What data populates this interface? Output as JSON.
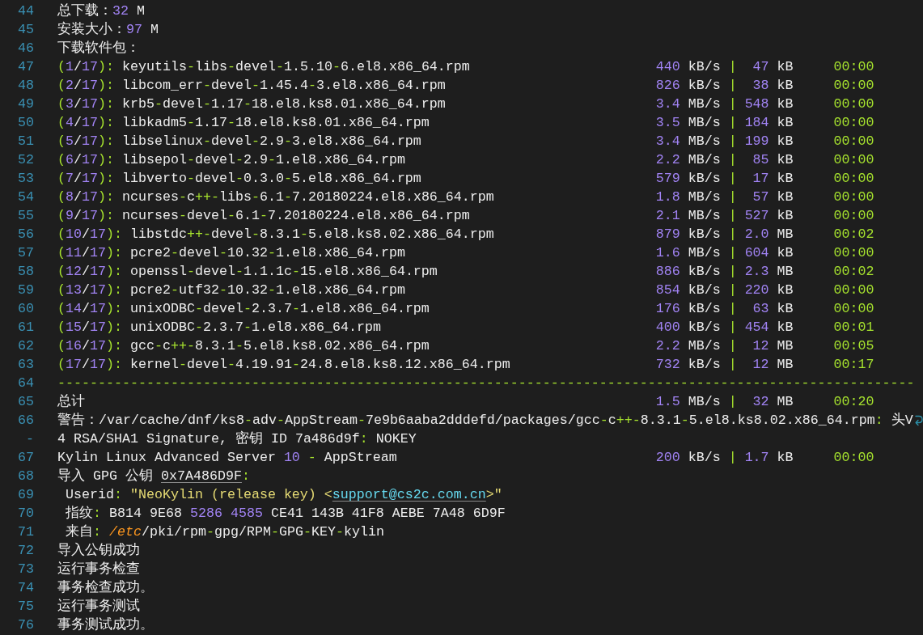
{
  "editor": {
    "lines": [
      {
        "number": "44",
        "wrapped": false,
        "tokens": [
          {
            "kind": "text",
            "text": "总下载："
          },
          {
            "kind": "number",
            "text": "32"
          },
          {
            "kind": "text",
            "text": " M"
          }
        ]
      },
      {
        "number": "45",
        "wrapped": false,
        "tokens": [
          {
            "kind": "text",
            "text": "安装大小："
          },
          {
            "kind": "number",
            "text": "97"
          },
          {
            "kind": "text",
            "text": " M"
          }
        ]
      },
      {
        "number": "46",
        "wrapped": false,
        "tokens": [
          {
            "kind": "text",
            "text": "下载软件包："
          }
        ]
      },
      {
        "number": "47",
        "wrapped": false,
        "tokens": [
          {
            "kind": "operator",
            "text": "("
          },
          {
            "kind": "number",
            "text": "1"
          },
          {
            "kind": "text",
            "text": "/"
          },
          {
            "kind": "number",
            "text": "17"
          },
          {
            "kind": "operator",
            "text": "):"
          },
          {
            "kind": "text",
            "text": " keyutils"
          },
          {
            "kind": "operator",
            "text": "-"
          },
          {
            "kind": "text",
            "text": "libs"
          },
          {
            "kind": "operator",
            "text": "-"
          },
          {
            "kind": "text",
            "text": "devel"
          },
          {
            "kind": "operator",
            "text": "-"
          },
          {
            "kind": "text",
            "text": "1.5.10"
          },
          {
            "kind": "operator",
            "text": "-"
          },
          {
            "kind": "text",
            "text": "6.el8.x86_64.rpm"
          }
        ],
        "transfer": {
          "speed": "440",
          "speed_unit": "kB/s",
          "separator": "|",
          "size": "47",
          "size_unit": "kB",
          "time": "00:00"
        }
      },
      {
        "number": "48",
        "wrapped": false,
        "tokens": [
          {
            "kind": "operator",
            "text": "("
          },
          {
            "kind": "number",
            "text": "2"
          },
          {
            "kind": "text",
            "text": "/"
          },
          {
            "kind": "number",
            "text": "17"
          },
          {
            "kind": "operator",
            "text": "):"
          },
          {
            "kind": "text",
            "text": " libcom_err"
          },
          {
            "kind": "operator",
            "text": "-"
          },
          {
            "kind": "text",
            "text": "devel"
          },
          {
            "kind": "operator",
            "text": "-"
          },
          {
            "kind": "text",
            "text": "1.45.4"
          },
          {
            "kind": "operator",
            "text": "-"
          },
          {
            "kind": "text",
            "text": "3.el8.x86_64.rpm"
          }
        ],
        "transfer": {
          "speed": "826",
          "speed_unit": "kB/s",
          "separator": "|",
          "size": "38",
          "size_unit": "kB",
          "time": "00:00"
        }
      },
      {
        "number": "49",
        "wrapped": false,
        "tokens": [
          {
            "kind": "operator",
            "text": "("
          },
          {
            "kind": "number",
            "text": "3"
          },
          {
            "kind": "text",
            "text": "/"
          },
          {
            "kind": "number",
            "text": "17"
          },
          {
            "kind": "operator",
            "text": "):"
          },
          {
            "kind": "text",
            "text": " krb5"
          },
          {
            "kind": "operator",
            "text": "-"
          },
          {
            "kind": "text",
            "text": "devel"
          },
          {
            "kind": "operator",
            "text": "-"
          },
          {
            "kind": "text",
            "text": "1.17"
          },
          {
            "kind": "operator",
            "text": "-"
          },
          {
            "kind": "text",
            "text": "18.el8.ks8.01.x86_64.rpm"
          }
        ],
        "transfer": {
          "speed": "3.4",
          "speed_unit": "MB/s",
          "separator": "|",
          "size": "548",
          "size_unit": "kB",
          "time": "00:00"
        }
      },
      {
        "number": "50",
        "wrapped": false,
        "tokens": [
          {
            "kind": "operator",
            "text": "("
          },
          {
            "kind": "number",
            "text": "4"
          },
          {
            "kind": "text",
            "text": "/"
          },
          {
            "kind": "number",
            "text": "17"
          },
          {
            "kind": "operator",
            "text": "):"
          },
          {
            "kind": "text",
            "text": " libkadm5"
          },
          {
            "kind": "operator",
            "text": "-"
          },
          {
            "kind": "text",
            "text": "1.17"
          },
          {
            "kind": "operator",
            "text": "-"
          },
          {
            "kind": "text",
            "text": "18.el8.ks8.01.x86_64.rpm"
          }
        ],
        "transfer": {
          "speed": "3.5",
          "speed_unit": "MB/s",
          "separator": "|",
          "size": "184",
          "size_unit": "kB",
          "time": "00:00"
        }
      },
      {
        "number": "51",
        "wrapped": false,
        "tokens": [
          {
            "kind": "operator",
            "text": "("
          },
          {
            "kind": "number",
            "text": "5"
          },
          {
            "kind": "text",
            "text": "/"
          },
          {
            "kind": "number",
            "text": "17"
          },
          {
            "kind": "operator",
            "text": "):"
          },
          {
            "kind": "text",
            "text": " libselinux"
          },
          {
            "kind": "operator",
            "text": "-"
          },
          {
            "kind": "text",
            "text": "devel"
          },
          {
            "kind": "operator",
            "text": "-"
          },
          {
            "kind": "text",
            "text": "2.9"
          },
          {
            "kind": "operator",
            "text": "-"
          },
          {
            "kind": "text",
            "text": "3.el8.x86_64.rpm"
          }
        ],
        "transfer": {
          "speed": "3.4",
          "speed_unit": "MB/s",
          "separator": "|",
          "size": "199",
          "size_unit": "kB",
          "time": "00:00"
        }
      },
      {
        "number": "52",
        "wrapped": false,
        "tokens": [
          {
            "kind": "operator",
            "text": "("
          },
          {
            "kind": "number",
            "text": "6"
          },
          {
            "kind": "text",
            "text": "/"
          },
          {
            "kind": "number",
            "text": "17"
          },
          {
            "kind": "operator",
            "text": "):"
          },
          {
            "kind": "text",
            "text": " libsepol"
          },
          {
            "kind": "operator",
            "text": "-"
          },
          {
            "kind": "text",
            "text": "devel"
          },
          {
            "kind": "operator",
            "text": "-"
          },
          {
            "kind": "text",
            "text": "2.9"
          },
          {
            "kind": "operator",
            "text": "-"
          },
          {
            "kind": "text",
            "text": "1.el8.x86_64.rpm"
          }
        ],
        "transfer": {
          "speed": "2.2",
          "speed_unit": "MB/s",
          "separator": "|",
          "size": "85",
          "size_unit": "kB",
          "time": "00:00"
        }
      },
      {
        "number": "53",
        "wrapped": false,
        "tokens": [
          {
            "kind": "operator",
            "text": "("
          },
          {
            "kind": "number",
            "text": "7"
          },
          {
            "kind": "text",
            "text": "/"
          },
          {
            "kind": "number",
            "text": "17"
          },
          {
            "kind": "operator",
            "text": "):"
          },
          {
            "kind": "text",
            "text": " libverto"
          },
          {
            "kind": "operator",
            "text": "-"
          },
          {
            "kind": "text",
            "text": "devel"
          },
          {
            "kind": "operator",
            "text": "-"
          },
          {
            "kind": "text",
            "text": "0.3.0"
          },
          {
            "kind": "operator",
            "text": "-"
          },
          {
            "kind": "text",
            "text": "5.el8.x86_64.rpm"
          }
        ],
        "transfer": {
          "speed": "579",
          "speed_unit": "kB/s",
          "separator": "|",
          "size": "17",
          "size_unit": "kB",
          "time": "00:00"
        }
      },
      {
        "number": "54",
        "wrapped": false,
        "tokens": [
          {
            "kind": "operator",
            "text": "("
          },
          {
            "kind": "number",
            "text": "8"
          },
          {
            "kind": "text",
            "text": "/"
          },
          {
            "kind": "number",
            "text": "17"
          },
          {
            "kind": "operator",
            "text": "):"
          },
          {
            "kind": "text",
            "text": " ncurses"
          },
          {
            "kind": "operator",
            "text": "-"
          },
          {
            "kind": "text",
            "text": "c"
          },
          {
            "kind": "operator",
            "text": "++-"
          },
          {
            "kind": "text",
            "text": "libs"
          },
          {
            "kind": "operator",
            "text": "-"
          },
          {
            "kind": "text",
            "text": "6.1"
          },
          {
            "kind": "operator",
            "text": "-"
          },
          {
            "kind": "text",
            "text": "7.20180224.el8.x86_64.rpm"
          }
        ],
        "transfer": {
          "speed": "1.8",
          "speed_unit": "MB/s",
          "separator": "|",
          "size": "57",
          "size_unit": "kB",
          "time": "00:00"
        }
      },
      {
        "number": "55",
        "wrapped": false,
        "tokens": [
          {
            "kind": "operator",
            "text": "("
          },
          {
            "kind": "number",
            "text": "9"
          },
          {
            "kind": "text",
            "text": "/"
          },
          {
            "kind": "number",
            "text": "17"
          },
          {
            "kind": "operator",
            "text": "):"
          },
          {
            "kind": "text",
            "text": " ncurses"
          },
          {
            "kind": "operator",
            "text": "-"
          },
          {
            "kind": "text",
            "text": "devel"
          },
          {
            "kind": "operator",
            "text": "-"
          },
          {
            "kind": "text",
            "text": "6.1"
          },
          {
            "kind": "operator",
            "text": "-"
          },
          {
            "kind": "text",
            "text": "7.20180224.el8.x86_64.rpm"
          }
        ],
        "transfer": {
          "speed": "2.1",
          "speed_unit": "MB/s",
          "separator": "|",
          "size": "527",
          "size_unit": "kB",
          "time": "00:00"
        }
      },
      {
        "number": "56",
        "wrapped": false,
        "tokens": [
          {
            "kind": "operator",
            "text": "("
          },
          {
            "kind": "number",
            "text": "10"
          },
          {
            "kind": "text",
            "text": "/"
          },
          {
            "kind": "number",
            "text": "17"
          },
          {
            "kind": "operator",
            "text": "):"
          },
          {
            "kind": "text",
            "text": " libstdc"
          },
          {
            "kind": "operator",
            "text": "++-"
          },
          {
            "kind": "text",
            "text": "devel"
          },
          {
            "kind": "operator",
            "text": "-"
          },
          {
            "kind": "text",
            "text": "8.3.1"
          },
          {
            "kind": "operator",
            "text": "-"
          },
          {
            "kind": "text",
            "text": "5.el8.ks8.02.x86_64.rpm"
          }
        ],
        "transfer": {
          "speed": "879",
          "speed_unit": "kB/s",
          "separator": "|",
          "size": "2.0",
          "size_unit": "MB",
          "time": "00:02"
        }
      },
      {
        "number": "57",
        "wrapped": false,
        "tokens": [
          {
            "kind": "operator",
            "text": "("
          },
          {
            "kind": "number",
            "text": "11"
          },
          {
            "kind": "text",
            "text": "/"
          },
          {
            "kind": "number",
            "text": "17"
          },
          {
            "kind": "operator",
            "text": "):"
          },
          {
            "kind": "text",
            "text": " pcre2"
          },
          {
            "kind": "operator",
            "text": "-"
          },
          {
            "kind": "text",
            "text": "devel"
          },
          {
            "kind": "operator",
            "text": "-"
          },
          {
            "kind": "text",
            "text": "10.32"
          },
          {
            "kind": "operator",
            "text": "-"
          },
          {
            "kind": "text",
            "text": "1.el8.x86_64.rpm"
          }
        ],
        "transfer": {
          "speed": "1.6",
          "speed_unit": "MB/s",
          "separator": "|",
          "size": "604",
          "size_unit": "kB",
          "time": "00:00"
        }
      },
      {
        "number": "58",
        "wrapped": false,
        "tokens": [
          {
            "kind": "operator",
            "text": "("
          },
          {
            "kind": "number",
            "text": "12"
          },
          {
            "kind": "text",
            "text": "/"
          },
          {
            "kind": "number",
            "text": "17"
          },
          {
            "kind": "operator",
            "text": "):"
          },
          {
            "kind": "text",
            "text": " openssl"
          },
          {
            "kind": "operator",
            "text": "-"
          },
          {
            "kind": "text",
            "text": "devel"
          },
          {
            "kind": "operator",
            "text": "-"
          },
          {
            "kind": "text",
            "text": "1.1.1c"
          },
          {
            "kind": "operator",
            "text": "-"
          },
          {
            "kind": "text",
            "text": "15.el8.x86_64.rpm"
          }
        ],
        "transfer": {
          "speed": "886",
          "speed_unit": "kB/s",
          "separator": "|",
          "size": "2.3",
          "size_unit": "MB",
          "time": "00:02"
        }
      },
      {
        "number": "59",
        "wrapped": false,
        "tokens": [
          {
            "kind": "operator",
            "text": "("
          },
          {
            "kind": "number",
            "text": "13"
          },
          {
            "kind": "text",
            "text": "/"
          },
          {
            "kind": "number",
            "text": "17"
          },
          {
            "kind": "operator",
            "text": "):"
          },
          {
            "kind": "text",
            "text": " pcre2"
          },
          {
            "kind": "operator",
            "text": "-"
          },
          {
            "kind": "text",
            "text": "utf32"
          },
          {
            "kind": "operator",
            "text": "-"
          },
          {
            "kind": "text",
            "text": "10.32"
          },
          {
            "kind": "operator",
            "text": "-"
          },
          {
            "kind": "text",
            "text": "1.el8.x86_64.rpm"
          }
        ],
        "transfer": {
          "speed": "854",
          "speed_unit": "kB/s",
          "separator": "|",
          "size": "220",
          "size_unit": "kB",
          "time": "00:00"
        }
      },
      {
        "number": "60",
        "wrapped": false,
        "tokens": [
          {
            "kind": "operator",
            "text": "("
          },
          {
            "kind": "number",
            "text": "14"
          },
          {
            "kind": "text",
            "text": "/"
          },
          {
            "kind": "number",
            "text": "17"
          },
          {
            "kind": "operator",
            "text": "):"
          },
          {
            "kind": "text",
            "text": " unixODBC"
          },
          {
            "kind": "operator",
            "text": "-"
          },
          {
            "kind": "text",
            "text": "devel"
          },
          {
            "kind": "operator",
            "text": "-"
          },
          {
            "kind": "text",
            "text": "2.3.7"
          },
          {
            "kind": "operator",
            "text": "-"
          },
          {
            "kind": "text",
            "text": "1.el8.x86_64.rpm"
          }
        ],
        "transfer": {
          "speed": "176",
          "speed_unit": "kB/s",
          "separator": "|",
          "size": "63",
          "size_unit": "kB",
          "time": "00:00"
        }
      },
      {
        "number": "61",
        "wrapped": false,
        "tokens": [
          {
            "kind": "operator",
            "text": "("
          },
          {
            "kind": "number",
            "text": "15"
          },
          {
            "kind": "text",
            "text": "/"
          },
          {
            "kind": "number",
            "text": "17"
          },
          {
            "kind": "operator",
            "text": "):"
          },
          {
            "kind": "text",
            "text": " unixODBC"
          },
          {
            "kind": "operator",
            "text": "-"
          },
          {
            "kind": "text",
            "text": "2.3.7"
          },
          {
            "kind": "operator",
            "text": "-"
          },
          {
            "kind": "text",
            "text": "1.el8.x86_64.rpm"
          }
        ],
        "transfer": {
          "speed": "400",
          "speed_unit": "kB/s",
          "separator": "|",
          "size": "454",
          "size_unit": "kB",
          "time": "00:01"
        }
      },
      {
        "number": "62",
        "wrapped": false,
        "tokens": [
          {
            "kind": "operator",
            "text": "("
          },
          {
            "kind": "number",
            "text": "16"
          },
          {
            "kind": "text",
            "text": "/"
          },
          {
            "kind": "number",
            "text": "17"
          },
          {
            "kind": "operator",
            "text": "):"
          },
          {
            "kind": "text",
            "text": " gcc"
          },
          {
            "kind": "operator",
            "text": "-"
          },
          {
            "kind": "text",
            "text": "c"
          },
          {
            "kind": "operator",
            "text": "++-"
          },
          {
            "kind": "text",
            "text": "8.3.1"
          },
          {
            "kind": "operator",
            "text": "-"
          },
          {
            "kind": "text",
            "text": "5.el8.ks8.02.x86_64.rpm"
          }
        ],
        "transfer": {
          "speed": "2.2",
          "speed_unit": "MB/s",
          "separator": "|",
          "size": "12",
          "size_unit": "MB",
          "time": "00:05"
        }
      },
      {
        "number": "63",
        "wrapped": false,
        "tokens": [
          {
            "kind": "operator",
            "text": "("
          },
          {
            "kind": "number",
            "text": "17"
          },
          {
            "kind": "text",
            "text": "/"
          },
          {
            "kind": "number",
            "text": "17"
          },
          {
            "kind": "operator",
            "text": "):"
          },
          {
            "kind": "text",
            "text": " kernel"
          },
          {
            "kind": "operator",
            "text": "-"
          },
          {
            "kind": "text",
            "text": "devel"
          },
          {
            "kind": "operator",
            "text": "-"
          },
          {
            "kind": "text",
            "text": "4.19.91"
          },
          {
            "kind": "operator",
            "text": "-"
          },
          {
            "kind": "text",
            "text": "24.8.el8.ks8.12.x86_64.rpm"
          }
        ],
        "transfer": {
          "speed": "732",
          "speed_unit": "kB/s",
          "separator": "|",
          "size": "12",
          "size_unit": "MB",
          "time": "00:17"
        }
      },
      {
        "number": "64",
        "wrapped": false,
        "tokens": [
          {
            "kind": "operator",
            "text": "----------------------------------------------------------------------------------------------------------"
          }
        ]
      },
      {
        "number": "65",
        "wrapped": false,
        "tokens": [
          {
            "kind": "text",
            "text": "总计"
          }
        ],
        "transfer": {
          "speed": "1.5",
          "speed_unit": "MB/s",
          "separator": "|",
          "size": "32",
          "size_unit": "MB",
          "time": "00:20"
        }
      },
      {
        "number": "66",
        "wrapped": true,
        "tokens": [
          {
            "kind": "text",
            "text": "警告：/var/cache/dnf/ks8"
          },
          {
            "kind": "operator",
            "text": "-"
          },
          {
            "kind": "text",
            "text": "adv"
          },
          {
            "kind": "operator",
            "text": "-"
          },
          {
            "kind": "text",
            "text": "AppStream"
          },
          {
            "kind": "operator",
            "text": "-"
          },
          {
            "kind": "text",
            "text": "7e9b6aaba2dddefd/packages/gcc"
          },
          {
            "kind": "operator",
            "text": "-"
          },
          {
            "kind": "text",
            "text": "c"
          },
          {
            "kind": "operator",
            "text": "++-"
          },
          {
            "kind": "text",
            "text": "8.3.1"
          },
          {
            "kind": "operator",
            "text": "-"
          },
          {
            "kind": "text",
            "text": "5.el8.ks8.02.x86_64.rpm"
          },
          {
            "kind": "operator",
            "text": ":"
          },
          {
            "kind": "text",
            "text": " 头V"
          }
        ]
      },
      {
        "number": "-",
        "wrapped": false,
        "tokens": [
          {
            "kind": "text",
            "text": "4 RSA/SHA1 Signature, 密钥 ID 7a486d9f"
          },
          {
            "kind": "operator",
            "text": ":"
          },
          {
            "kind": "text",
            "text": " NOKEY"
          }
        ]
      },
      {
        "number": "67",
        "wrapped": false,
        "tokens": [
          {
            "kind": "text",
            "text": "Kylin Linux Advanced Server "
          },
          {
            "kind": "number",
            "text": "10"
          },
          {
            "kind": "operator",
            "text": " -"
          },
          {
            "kind": "text",
            "text": " AppStream"
          }
        ],
        "transfer": {
          "speed": "200",
          "speed_unit": "kB/s",
          "separator": "|",
          "size": "1.7",
          "size_unit": "kB",
          "time": "00:00"
        }
      },
      {
        "number": "68",
        "wrapped": false,
        "tokens": [
          {
            "kind": "text",
            "text": "导入 GPG 公钥 "
          },
          {
            "kind": "underlined",
            "text": "0x7A486D9F"
          },
          {
            "kind": "operator",
            "text": ":"
          }
        ]
      },
      {
        "number": "69",
        "wrapped": false,
        "tokens": [
          {
            "kind": "text",
            "text": " Userid"
          },
          {
            "kind": "operator",
            "text": ":"
          },
          {
            "kind": "string",
            "text": " \"NeoKylin (release key) <"
          },
          {
            "kind": "link",
            "text": "support@cs2c.com.cn"
          },
          {
            "kind": "string",
            "text": ">\""
          }
        ]
      },
      {
        "number": "70",
        "wrapped": false,
        "tokens": [
          {
            "kind": "text",
            "text": " 指纹"
          },
          {
            "kind": "operator",
            "text": ":"
          },
          {
            "kind": "text",
            "text": " B814 9E68 "
          },
          {
            "kind": "number",
            "text": "5286 4585"
          },
          {
            "kind": "text",
            "text": " CE41 143B 41F8 AEBE 7A48 6D9F"
          }
        ]
      },
      {
        "number": "71",
        "wrapped": false,
        "tokens": [
          {
            "kind": "text",
            "text": " 来自"
          },
          {
            "kind": "operator",
            "text": ":"
          },
          {
            "kind": "path",
            "text": " /etc"
          },
          {
            "kind": "text",
            "text": "/pki/rpm"
          },
          {
            "kind": "operator",
            "text": "-"
          },
          {
            "kind": "text",
            "text": "gpg/RPM"
          },
          {
            "kind": "operator",
            "text": "-"
          },
          {
            "kind": "text",
            "text": "GPG"
          },
          {
            "kind": "operator",
            "text": "-"
          },
          {
            "kind": "text",
            "text": "KEY"
          },
          {
            "kind": "operator",
            "text": "-"
          },
          {
            "kind": "text",
            "text": "kylin"
          }
        ]
      },
      {
        "number": "72",
        "wrapped": false,
        "tokens": [
          {
            "kind": "text",
            "text": "导入公钥成功"
          }
        ]
      },
      {
        "number": "73",
        "wrapped": false,
        "tokens": [
          {
            "kind": "text",
            "text": "运行事务检查"
          }
        ]
      },
      {
        "number": "74",
        "wrapped": false,
        "tokens": [
          {
            "kind": "text",
            "text": "事务检查成功。"
          }
        ]
      },
      {
        "number": "75",
        "wrapped": false,
        "tokens": [
          {
            "kind": "text",
            "text": "运行事务测试"
          }
        ]
      },
      {
        "number": "76",
        "wrapped": false,
        "tokens": [
          {
            "kind": "text",
            "text": "事务测试成功。"
          }
        ]
      }
    ]
  }
}
